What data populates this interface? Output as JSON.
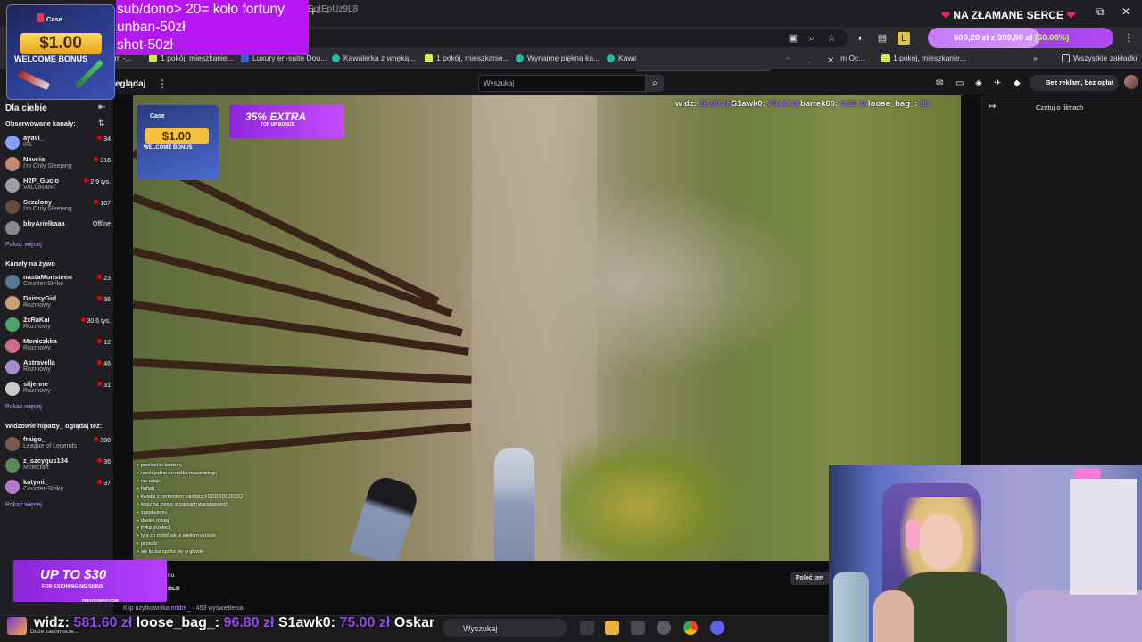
{
  "browser": {
    "url": "EqIEpUz9L8",
    "bookmarks": [
      "nium -...",
      "1 pokój, mieszkanie...",
      "Luxury en-suite Dou...",
      "Kawalerka z wnęką...",
      "1 pokój, mieszkanie...",
      "Wynajmę piękną ka...",
      "Kawa",
      "m Oc...",
      "1 pokój, mieszkanie..."
    ],
    "all_bookmarks": "Wszystkie zakładki"
  },
  "twitch": {
    "browse": "eglądaj",
    "search_placeholder": "Wyszukaj",
    "ad_free": "Bez reklam, bez opłat",
    "sidebar": {
      "for_you": "Dla ciebie",
      "followed_title": "Obserwowane kanały:",
      "followed": [
        {
          "name": "ayavi_",
          "game": "IRL",
          "viewers": "34",
          "color": "#7fa3ff"
        },
        {
          "name": "Navcia",
          "game": "I'm Only Sleeping",
          "viewers": "216",
          "color": "#c28b6a"
        },
        {
          "name": "H2P_Gucio",
          "game": "VALORANT",
          "viewers": "2,9 tys.",
          "color": "#9f9f9f"
        },
        {
          "name": "Szzalony",
          "game": "I'm Only Sleeping",
          "viewers": "107",
          "color": "#6a4c3a"
        },
        {
          "name": "bbyArielkaaa",
          "game": "",
          "viewers": "Offline",
          "color": "#8a8a8a"
        }
      ],
      "show_more": "Pokaż więcej",
      "live_title": "Kanały na żywo",
      "live": [
        {
          "name": "nastaMonsteerr",
          "game": "Counter-Strike",
          "viewers": "23",
          "color": "#5b7a9a"
        },
        {
          "name": "DaissyGirl",
          "game": "Rozmowy",
          "viewers": "36",
          "color": "#c7a070"
        },
        {
          "name": "2xRaKai",
          "game": "Rozmowy",
          "viewers": "30,6 tys.",
          "color": "#4aa36a"
        },
        {
          "name": "Moniczkka",
          "game": "Rozmowy",
          "viewers": "12",
          "color": "#d06a8a"
        },
        {
          "name": "Astravella",
          "game": "Rozmowy",
          "viewers": "46",
          "color": "#a98ad0"
        },
        {
          "name": "siljenne",
          "game": "Rozmowy",
          "viewers": "31",
          "color": "#c9c9c9"
        }
      ],
      "also_title": "Widzowie hipatty_ oglądaj też:",
      "also": [
        {
          "name": "fraigo_",
          "game": "League of Legends",
          "viewers": "380",
          "color": "#7a5a4a"
        },
        {
          "name": "z_szcygus134",
          "game": "Minecraft",
          "viewers": "36",
          "color": "#5a8a5a"
        },
        {
          "name": "katymi_",
          "game": "Counter-Strike",
          "viewers": "37",
          "color": "#b07ad0"
        }
      ]
    },
    "chat_panel_title": "Czatuj o filmach",
    "stream_label_a": "nu",
    "stream_label_b": "OLD",
    "clip_prefix": "Klip użytkownika",
    "clip_user": "mfdrn_",
    "clip_suffix": "· 453 wyświetlenia",
    "recommend": "Poleć ten"
  },
  "overlays": {
    "case_logo": "Case",
    "case_price": "$1.00",
    "case_sub": "WELCOME BONUS",
    "extra_big": "35% EXTRA",
    "extra_small": "TOP UP BONUS",
    "wheel_lines": [
      "sub/dono> 20= koło fortuny",
      "unban-50zł",
      "shot-50zł"
    ],
    "heart_title": "NA ZŁAMANE SERCE",
    "goal_amount": "600,20 zł z 999,00 zł",
    "goal_pct": "(60.08%)",
    "goal_fraction": 0.6008,
    "donos": [
      {
        "name": "widz:",
        "amt": "96.80 zł"
      },
      {
        "name": "S1awk0:",
        "amt": "75.00 zł"
      },
      {
        "name": "bartek69:",
        "amt": "5.69 zł"
      },
      {
        "name": "loose_bag_:",
        "amt": "96"
      }
    ],
    "ticker": [
      {
        "name": "widz:",
        "amt": "581.60 zł"
      },
      {
        "name": "loose_bag_:",
        "amt": "96.80 zł"
      },
      {
        "name": "S1awk0:",
        "amt": "75.00 zł"
      },
      {
        "name": "Oskar",
        "amt": ""
      }
    ],
    "ticker_sub": "Duże zachmurze...",
    "skins_big": "UP TO $30",
    "skins_small": "FOR EXCHANGING SKINS",
    "skins_url": "PIRATESWAP.COM",
    "chat_lines": [
      "przeleci to konkurs",
      "niech jedzie do miśka mazurskiego",
      "nie udaje",
      "hahah",
      "kwiatki z cementem zajebisz XDDDDDDDDDD",
      "teraz na zgode w parkach warszawskich",
      "zapakujemy",
      "dasiek mikiej",
      "fryka przeleci",
      "ty a co zrobił tak w wielkim skrócie",
      "pimeski",
      "ale lecisz spoko się w głowie"
    ]
  },
  "taskbar": {
    "search": "Wyszukaj"
  }
}
